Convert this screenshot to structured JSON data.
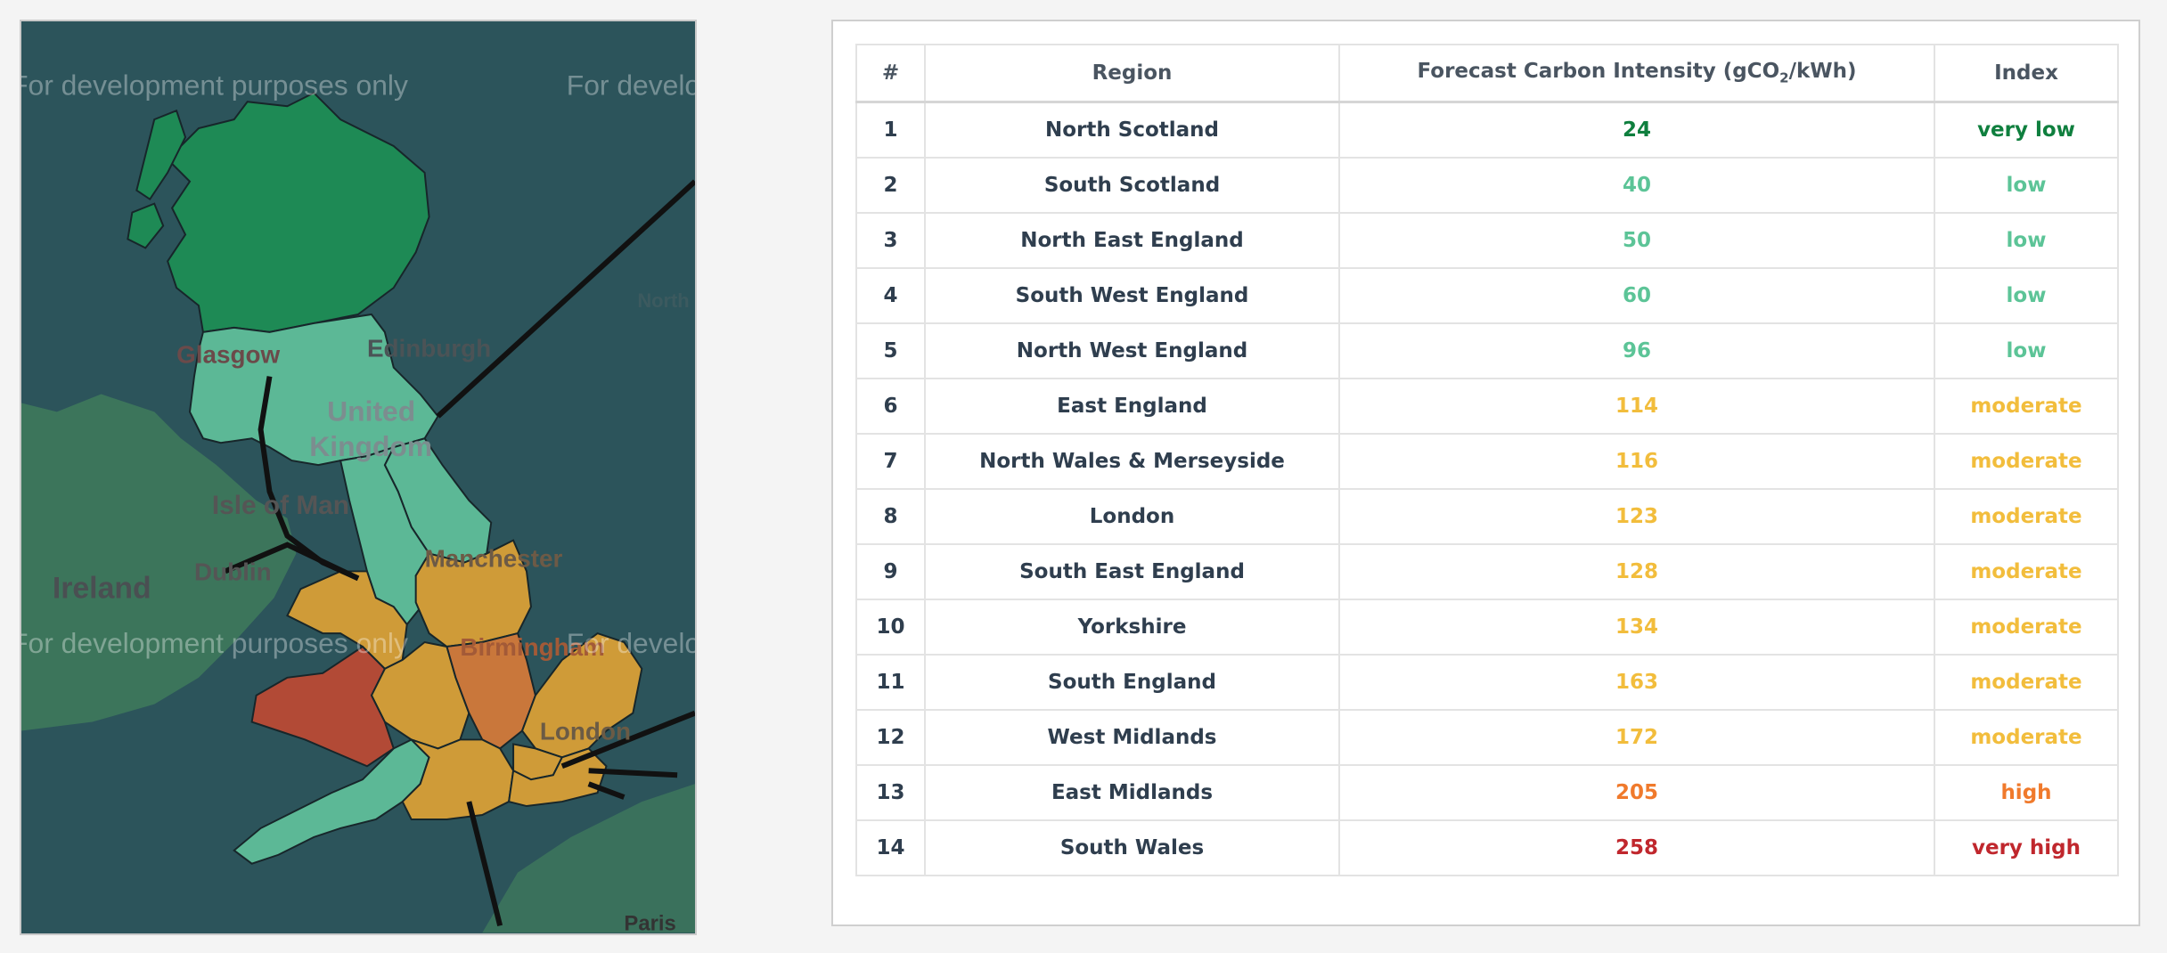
{
  "map": {
    "watermark_text": "For development purposes only",
    "labels": {
      "edinburgh": "Edinburgh",
      "glasgow": "Glasgow",
      "united": "United",
      "kingdom": "Kingdom",
      "isle_of_man": "Isle of Man",
      "dublin": "Dublin",
      "ireland": "Ireland",
      "manchester": "Manchester",
      "birmingham": "Birmingham",
      "london": "London",
      "north_fragment": "North",
      "paris_fragment": "Paris"
    }
  },
  "table": {
    "headers": {
      "num": "#",
      "region": "Region",
      "value_prefix": "Forecast Carbon Intensity (gCO",
      "value_sub": "2",
      "value_suffix": "/kWh)",
      "index": "Index"
    },
    "colors": {
      "very low": "#0f7f3e",
      "low": "#5cc497",
      "moderate": "#f2bd3c",
      "high": "#f07a2c",
      "very high": "#c0272d"
    },
    "rows": [
      {
        "num": "1",
        "region": "North Scotland",
        "value": "24",
        "index": "very low"
      },
      {
        "num": "2",
        "region": "South Scotland",
        "value": "40",
        "index": "low"
      },
      {
        "num": "3",
        "region": "North East England",
        "value": "50",
        "index": "low"
      },
      {
        "num": "4",
        "region": "South West England",
        "value": "60",
        "index": "low"
      },
      {
        "num": "5",
        "region": "North West England",
        "value": "96",
        "index": "low"
      },
      {
        "num": "6",
        "region": "East England",
        "value": "114",
        "index": "moderate"
      },
      {
        "num": "7",
        "region": "North Wales & Merseyside",
        "value": "116",
        "index": "moderate"
      },
      {
        "num": "8",
        "region": "London",
        "value": "123",
        "index": "moderate"
      },
      {
        "num": "9",
        "region": "South East England",
        "value": "128",
        "index": "moderate"
      },
      {
        "num": "10",
        "region": "Yorkshire",
        "value": "134",
        "index": "moderate"
      },
      {
        "num": "11",
        "region": "South England",
        "value": "163",
        "index": "moderate"
      },
      {
        "num": "12",
        "region": "West Midlands",
        "value": "172",
        "index": "moderate"
      },
      {
        "num": "13",
        "region": "East Midlands",
        "value": "205",
        "index": "high"
      },
      {
        "num": "14",
        "region": "South Wales",
        "value": "258",
        "index": "very high"
      }
    ]
  }
}
